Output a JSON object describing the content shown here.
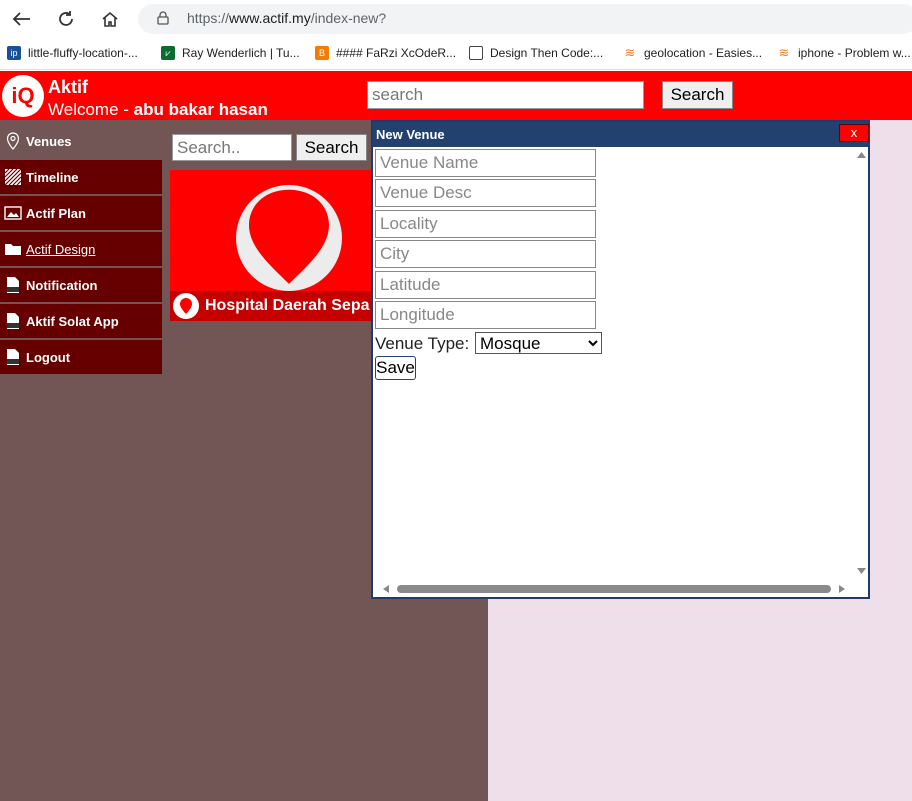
{
  "browser": {
    "url_scheme": "https://",
    "url_host": "www.actif.my",
    "url_path": "/index-new?",
    "bookmarks": [
      {
        "label": "little-fluffy-location-...",
        "icon": "ip-icon",
        "color": "#1a4f9c"
      },
      {
        "label": "Ray Wenderlich | Tu...",
        "icon": "rw-icon",
        "color": "#0c6b2e"
      },
      {
        "label": "#### FaRzi XcOdeR...",
        "icon": "blogger-icon",
        "color": "#f57c00"
      },
      {
        "label": "Design Then Code:...",
        "icon": "page-icon",
        "color": "#ffffff"
      },
      {
        "label": "geolocation - Easies...",
        "icon": "stackoverflow-icon",
        "color": "#f48024"
      },
      {
        "label": "iphone - Problem w...",
        "icon": "stackoverflow-icon",
        "color": "#f48024"
      }
    ]
  },
  "header": {
    "logo_text": "iQ",
    "title": "Aktif",
    "welcome_prefix": "Welcome - ",
    "user_name": "abu bakar hasan",
    "search_placeholder": "search",
    "search_button": "Search",
    "accent": "#ff0000"
  },
  "sidebar": {
    "items": [
      {
        "label": "Venues",
        "icon": "location-pin-icon"
      },
      {
        "label": "Timeline",
        "icon": "hatched-square-icon"
      },
      {
        "label": "Actif Plan",
        "icon": "image-icon"
      },
      {
        "label": "Actif Design",
        "icon": "folder-icon"
      },
      {
        "label": "Notification",
        "icon": "txt-file-icon"
      },
      {
        "label": "Aktif Solat App",
        "icon": "txt-file-icon"
      },
      {
        "label": "Logout",
        "icon": "txt-file-icon"
      }
    ]
  },
  "content": {
    "search_placeholder": "Search..",
    "search_button": "Search",
    "venue_card_title": "Hospital Daerah Sepa"
  },
  "modal": {
    "title": "New Venue",
    "close_label": "x",
    "fields": [
      {
        "placeholder": "Venue Name"
      },
      {
        "placeholder": "Venue Desc"
      },
      {
        "placeholder": "Locality"
      },
      {
        "placeholder": "City"
      },
      {
        "placeholder": "Latitude"
      },
      {
        "placeholder": "Longitude"
      }
    ],
    "venue_type_label": "Venue Type:",
    "venue_type_selected": "Mosque",
    "save_label": "Save",
    "header_color": "#23416f"
  }
}
